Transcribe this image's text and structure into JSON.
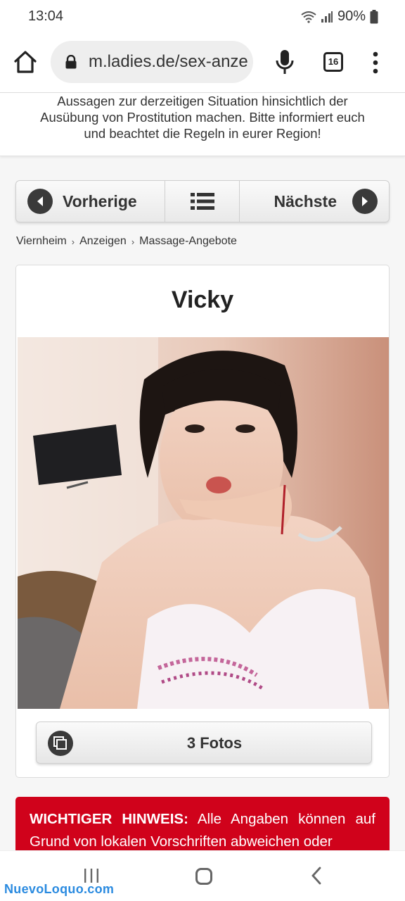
{
  "status_bar": {
    "time": "13:04",
    "battery": "90%",
    "icons": [
      "wifi-icon",
      "signal-icon",
      "battery-icon"
    ]
  },
  "browser": {
    "url": "m.ladies.de/sex-anze",
    "tab_count": "16",
    "icons": [
      "home-icon",
      "lock-icon",
      "mic-icon",
      "tabs-icon",
      "more-icon"
    ]
  },
  "page": {
    "top_notice": {
      "line1": "Aussagen zur derzeitigen Situation hinsichtlich der",
      "line2": "Ausübung von Prostitution machen. Bitte informiert euch",
      "line3": "und beachtet die Regeln in eurer Region!"
    },
    "nav": {
      "prev_label": "Vorherige",
      "next_label": "Nächste"
    },
    "breadcrumb": [
      "Viernheim",
      "Anzeigen",
      "Massage-Angebote"
    ],
    "listing": {
      "title": "Vicky",
      "photos_label": "3 Fotos"
    },
    "warning": {
      "heading": "WICHTIGER HINWEIS:",
      "text": " Alle Angaben können auf Grund von lokalen Vorschriften abweichen oder"
    }
  },
  "watermark": "NuevoLoquo.com",
  "colors": {
    "warning_bg": "#d0021b",
    "watermark": "#2b8be0",
    "button_icon": "#3a3a3a"
  }
}
